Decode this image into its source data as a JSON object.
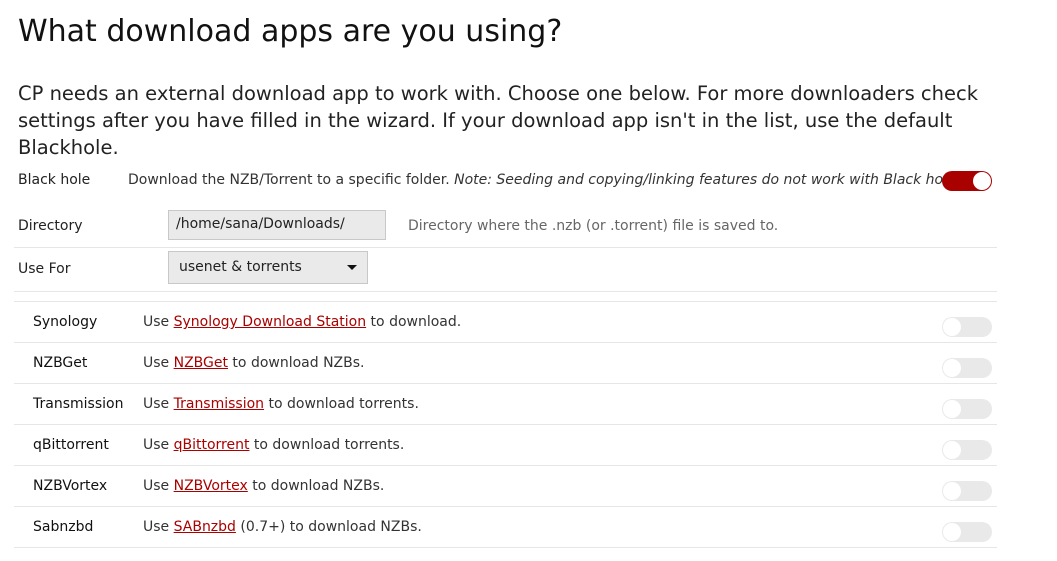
{
  "title": "What download apps are you using?",
  "intro": "CP needs an external download app to work with. Choose one below. For more downloaders check settings after you have filled in the wizard. If your download app isn't in the list, use the default Blackhole.",
  "blackhole": {
    "label": "Black hole",
    "desc": "Download the NZB/Torrent to a specific folder. ",
    "note": "Note: Seeding and copying/linking features do not work with Black hole",
    "note_end": ".",
    "enabled": true
  },
  "directory": {
    "label": "Directory",
    "value": "/home/sana/Downloads/",
    "hint": "Directory where the .nzb (or .torrent) file is saved to."
  },
  "use_for": {
    "label": "Use For",
    "value": "usenet & torrents"
  },
  "accent": "#a90000",
  "apps": [
    {
      "name": "Synology",
      "pre": "Use ",
      "link": "Synology Download Station",
      "post": " to download.",
      "enabled": false
    },
    {
      "name": "NZBGet",
      "pre": "Use ",
      "link": "NZBGet",
      "post": " to download NZBs.",
      "enabled": false
    },
    {
      "name": "Transmission",
      "pre": "Use ",
      "link": "Transmission",
      "post": " to download torrents.",
      "enabled": false
    },
    {
      "name": "qBittorrent",
      "pre": "Use ",
      "link": "qBittorrent",
      "post": " to download torrents.",
      "enabled": false
    },
    {
      "name": "NZBVortex",
      "pre": "Use ",
      "link": "NZBVortex",
      "post": " to download NZBs.",
      "enabled": false
    },
    {
      "name": "Sabnzbd",
      "pre": "Use ",
      "link": "SABnzbd",
      "post": " (0.7+) to download NZBs.",
      "enabled": false
    }
  ]
}
